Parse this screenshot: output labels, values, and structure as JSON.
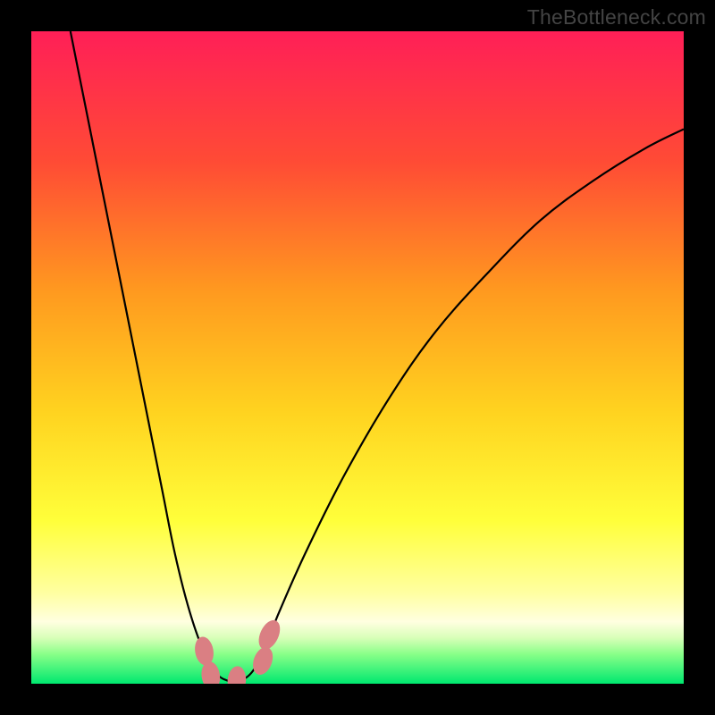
{
  "watermark": {
    "text": "TheBottleneck.com"
  },
  "colors": {
    "frame": "#000000",
    "curve": "#000000",
    "marker_fill": "#da7f83",
    "marker_stroke": "#cc6a6e",
    "gradient_stops": [
      {
        "offset": 0.0,
        "color": "#ff1f57"
      },
      {
        "offset": 0.2,
        "color": "#ff4b35"
      },
      {
        "offset": 0.4,
        "color": "#ff9a1f"
      },
      {
        "offset": 0.58,
        "color": "#ffd21f"
      },
      {
        "offset": 0.75,
        "color": "#ffff3a"
      },
      {
        "offset": 0.86,
        "color": "#ffffa0"
      },
      {
        "offset": 0.905,
        "color": "#ffffe0"
      },
      {
        "offset": 0.93,
        "color": "#d8ffb8"
      },
      {
        "offset": 0.955,
        "color": "#88ff88"
      },
      {
        "offset": 1.0,
        "color": "#00e86f"
      }
    ]
  },
  "chart_data": {
    "type": "line",
    "title": "",
    "xlabel": "",
    "ylabel": "",
    "x_range": [
      0,
      100
    ],
    "y_range": [
      0,
      100
    ],
    "curve_points": [
      {
        "x": 6,
        "y": 100
      },
      {
        "x": 8,
        "y": 90
      },
      {
        "x": 10,
        "y": 80
      },
      {
        "x": 12,
        "y": 70
      },
      {
        "x": 14,
        "y": 60
      },
      {
        "x": 16,
        "y": 50
      },
      {
        "x": 18,
        "y": 40
      },
      {
        "x": 20,
        "y": 30
      },
      {
        "x": 22,
        "y": 20
      },
      {
        "x": 24,
        "y": 12
      },
      {
        "x": 26,
        "y": 6
      },
      {
        "x": 28,
        "y": 2
      },
      {
        "x": 30,
        "y": 0.5
      },
      {
        "x": 32,
        "y": 0.5
      },
      {
        "x": 34,
        "y": 2
      },
      {
        "x": 36,
        "y": 6
      },
      {
        "x": 38,
        "y": 11
      },
      {
        "x": 42,
        "y": 20
      },
      {
        "x": 48,
        "y": 32
      },
      {
        "x": 55,
        "y": 44
      },
      {
        "x": 62,
        "y": 54
      },
      {
        "x": 70,
        "y": 63
      },
      {
        "x": 78,
        "y": 71
      },
      {
        "x": 86,
        "y": 77
      },
      {
        "x": 94,
        "y": 82
      },
      {
        "x": 100,
        "y": 85
      }
    ],
    "markers": [
      {
        "x": 26.5,
        "y": 5.0,
        "rx": 1.4,
        "ry": 2.2,
        "rot": -10
      },
      {
        "x": 27.5,
        "y": 1.2,
        "rx": 1.4,
        "ry": 2.2,
        "rot": -8
      },
      {
        "x": 31.5,
        "y": 0.5,
        "rx": 1.4,
        "ry": 2.2,
        "rot": 5
      },
      {
        "x": 35.5,
        "y": 3.5,
        "rx": 1.4,
        "ry": 2.2,
        "rot": 20
      },
      {
        "x": 36.5,
        "y": 7.5,
        "rx": 1.4,
        "ry": 2.4,
        "rot": 25
      }
    ]
  }
}
